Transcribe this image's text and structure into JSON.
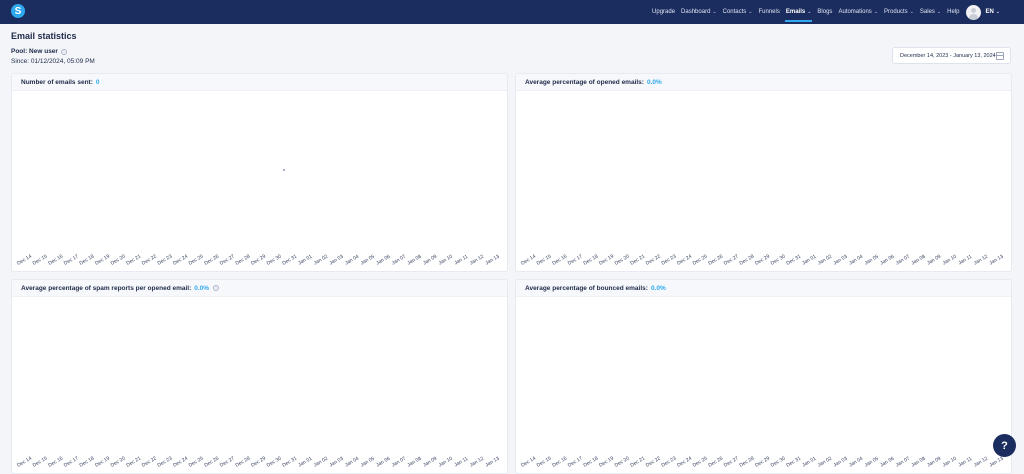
{
  "nav": {
    "logo_letter": "S",
    "items": [
      {
        "label": "Upgrade",
        "dropdown": false,
        "active": false
      },
      {
        "label": "Dashboard",
        "dropdown": true,
        "active": false
      },
      {
        "label": "Contacts",
        "dropdown": true,
        "active": false
      },
      {
        "label": "Funnels",
        "dropdown": false,
        "active": false
      },
      {
        "label": "Emails",
        "dropdown": true,
        "active": true
      },
      {
        "label": "Blogs",
        "dropdown": false,
        "active": false
      },
      {
        "label": "Automations",
        "dropdown": true,
        "active": false
      },
      {
        "label": "Products",
        "dropdown": true,
        "active": false
      },
      {
        "label": "Sales",
        "dropdown": true,
        "active": false
      },
      {
        "label": "Help",
        "dropdown": false,
        "active": false
      }
    ],
    "language": "EN"
  },
  "header": {
    "title": "Email statistics",
    "pool_label": "Pool: New user",
    "since": "Since: 01/12/2024, 05:09 PM",
    "date_range": "December 14, 2023 - January 13, 2024"
  },
  "panels": [
    {
      "id": "sent",
      "title": "Number of emails sent:",
      "value": "0",
      "info": false,
      "dot": true
    },
    {
      "id": "opened",
      "title": "Average percentage of opened emails:",
      "value": "0.0%",
      "info": false,
      "dot": false
    },
    {
      "id": "spam",
      "title": "Average percentage of spam reports per opened email:",
      "value": "0.0%",
      "info": true,
      "dot": false
    },
    {
      "id": "bounced",
      "title": "Average percentage of bounced emails:",
      "value": "0.0%",
      "info": false,
      "dot": false
    }
  ],
  "x_ticks": [
    "Dec 14",
    "Dec 15",
    "Dec 16",
    "Dec 17",
    "Dec 18",
    "Dec 19",
    "Dec 20",
    "Dec 21",
    "Dec 22",
    "Dec 23",
    "Dec 24",
    "Dec 25",
    "Dec 26",
    "Dec 27",
    "Dec 28",
    "Dec 29",
    "Dec 30",
    "Dec 31",
    "Jan 01",
    "Jan 02",
    "Jan 03",
    "Jan 04",
    "Jan 05",
    "Jan 06",
    "Jan 07",
    "Jan 08",
    "Jan 09",
    "Jan 10",
    "Jan 11",
    "Jan 12",
    "Jan 13"
  ],
  "colors": {
    "navbar": "#1b2c5e",
    "accent": "#2fa8f0",
    "background": "#f3f5f9"
  },
  "help_label": "?"
}
